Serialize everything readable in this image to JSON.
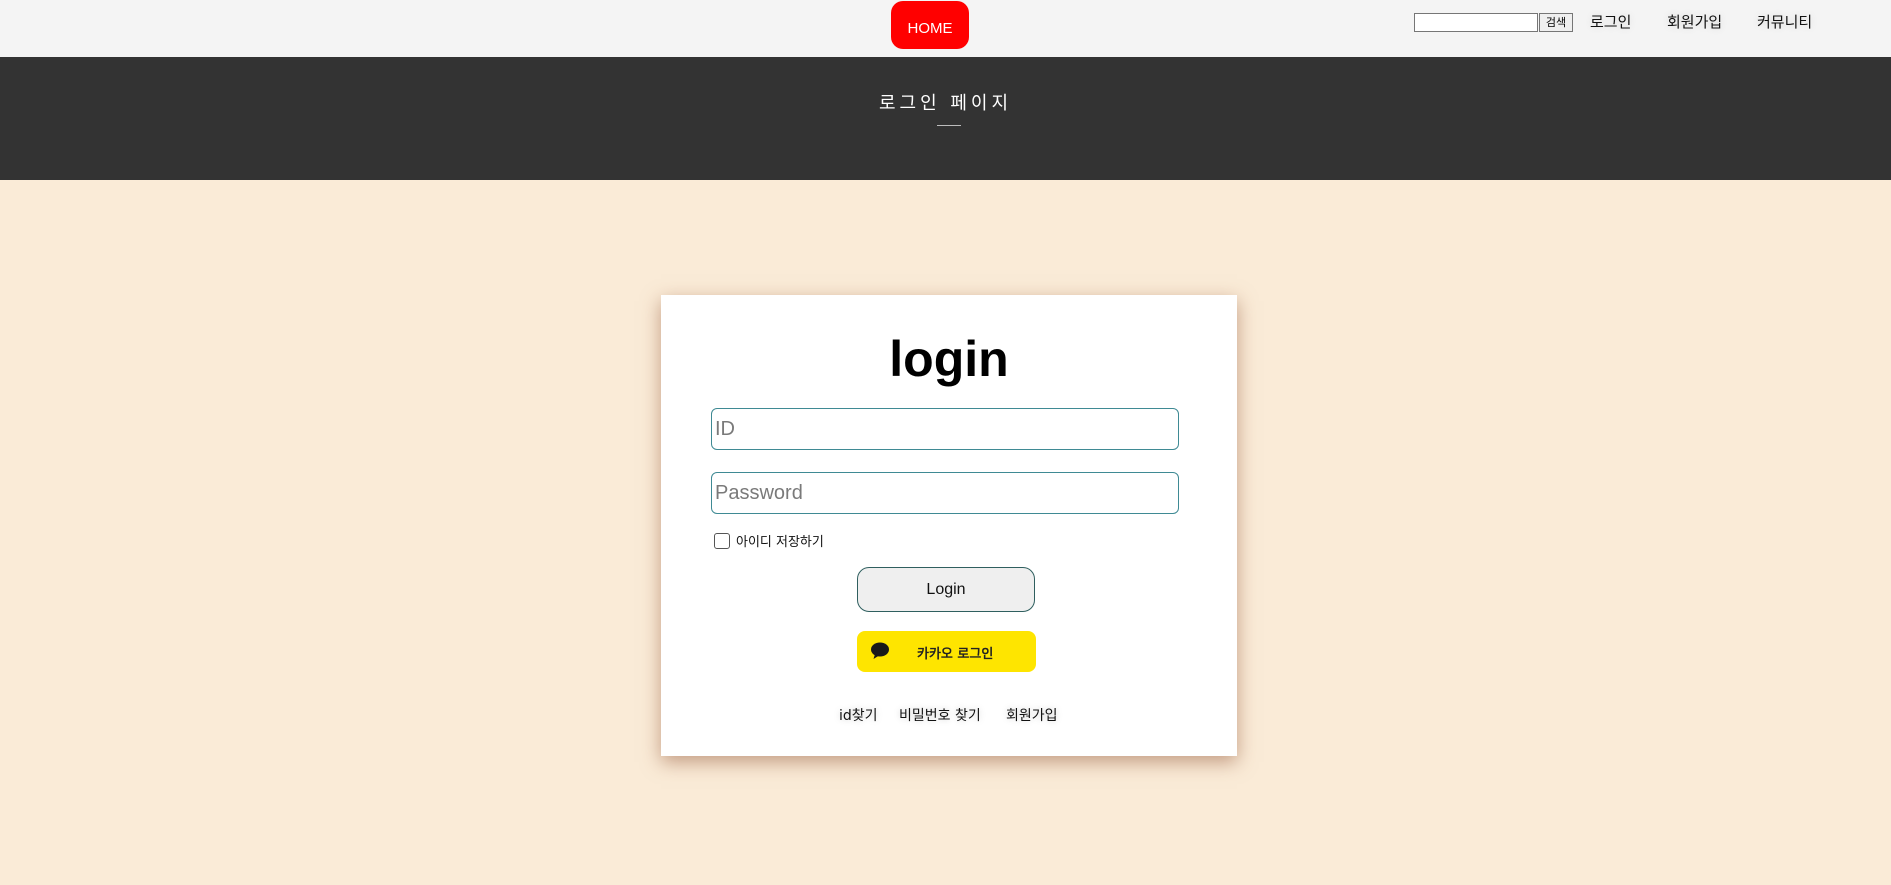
{
  "header": {
    "home_label": "HOME",
    "search_placeholder": "",
    "search_button": "검색",
    "nav": [
      "로그인",
      "회원가입",
      "커뮤니티"
    ]
  },
  "banner": {
    "title": "로그인 페이지"
  },
  "login_card": {
    "title": "login",
    "id_placeholder": "ID",
    "password_placeholder": "Password",
    "remember_label": "아이디 저장하기",
    "remember_checked": false,
    "login_button": "Login",
    "kakao_button": "카카오 로그인",
    "links": [
      "id찾기",
      "비밀번호 찾기",
      "회원가입"
    ]
  },
  "colors": {
    "home_button": "#ff0000",
    "banner_bg": "#333333",
    "page_bg": "#faebd7",
    "kakao": "#fee500"
  }
}
